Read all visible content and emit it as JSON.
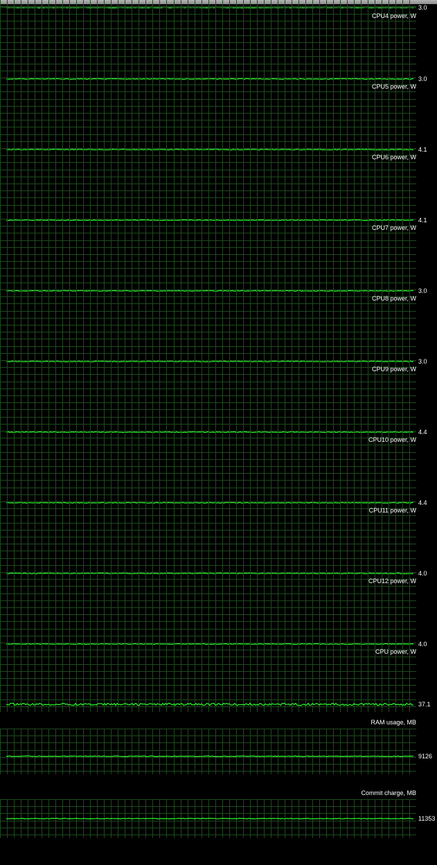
{
  "colors": {
    "background": "#000000",
    "grid": "#1f4a1f",
    "trace": "#2dff2d",
    "text": "#ffffff"
  },
  "panels": [
    {
      "label": "",
      "value": "3.0"
    },
    {
      "label": "CPU4 power, W",
      "value": "3.0"
    },
    {
      "label": "CPU5 power, W",
      "value": "4.1"
    },
    {
      "label": "CPU6 power, W",
      "value": "4.1"
    },
    {
      "label": "CPU7 power, W",
      "value": "3.0"
    },
    {
      "label": "CPU8 power, W",
      "value": "3.0"
    },
    {
      "label": "CPU9 power, W",
      "value": "4.4"
    },
    {
      "label": "CPU10 power, W",
      "value": "4.4"
    },
    {
      "label": "CPU11 power, W",
      "value": "4.0"
    },
    {
      "label": "CPU12 power, W",
      "value": "4.0"
    },
    {
      "label": "CPU power, W",
      "value": "37.1"
    },
    {
      "label": "RAM usage, MB",
      "value": "9126"
    },
    {
      "label": "Commit charge, MB",
      "value": "11353"
    }
  ]
}
